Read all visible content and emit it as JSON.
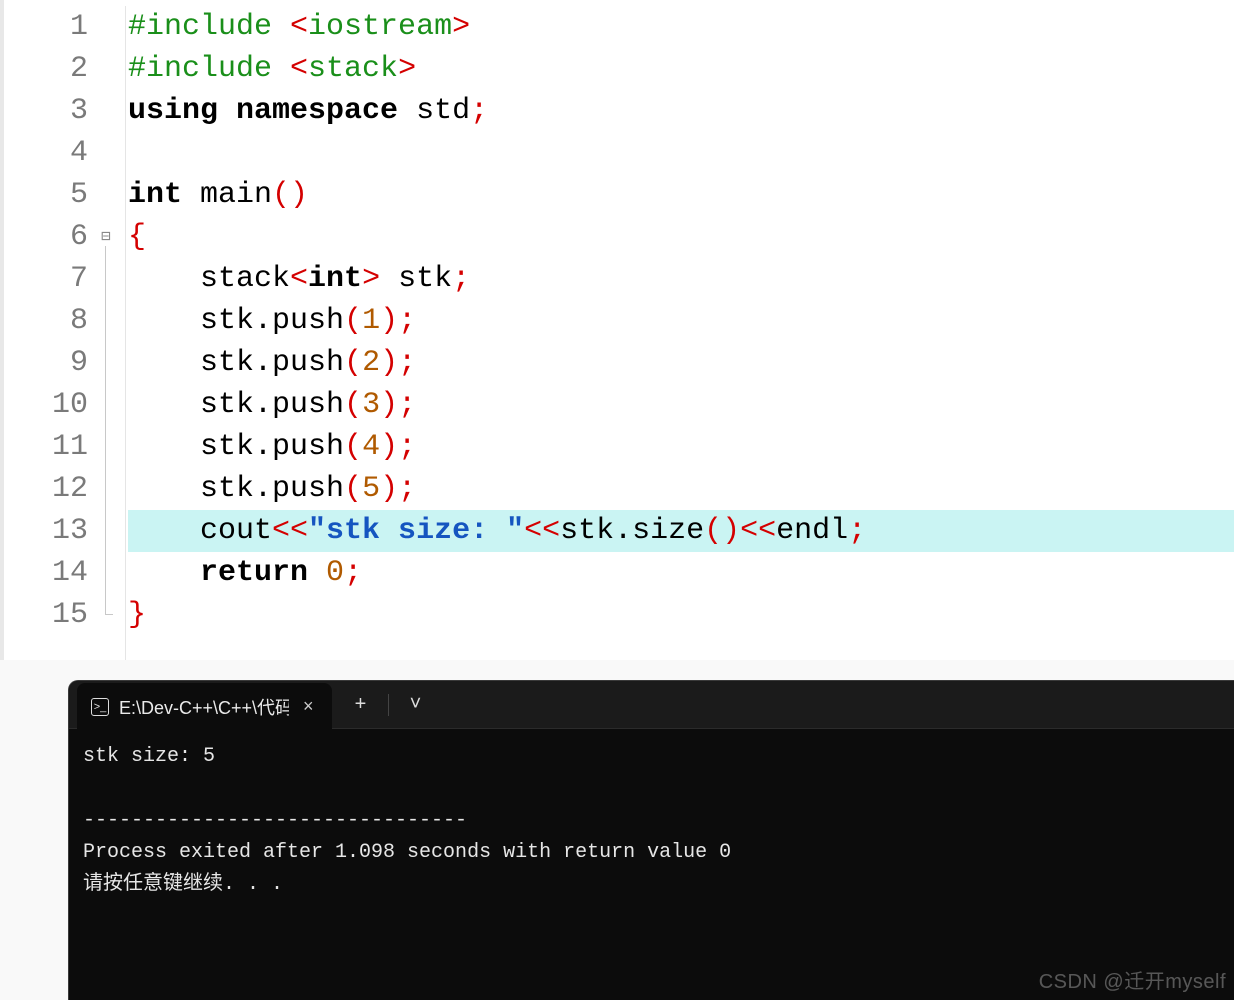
{
  "editor": {
    "highlighted_line": 13,
    "fold_start_line": 6,
    "fold_end_line": 15,
    "lines": [
      {
        "n": 1,
        "tokens": [
          [
            "kw-pp",
            "#include "
          ],
          [
            "sym",
            "<"
          ],
          [
            "kw-pp",
            "iostream"
          ],
          [
            "sym",
            ">"
          ]
        ]
      },
      {
        "n": 2,
        "tokens": [
          [
            "kw-pp",
            "#include "
          ],
          [
            "sym",
            "<"
          ],
          [
            "kw-pp",
            "stack"
          ],
          [
            "sym",
            ">"
          ]
        ]
      },
      {
        "n": 3,
        "tokens": [
          [
            "kw",
            "using "
          ],
          [
            "kw",
            "namespace "
          ],
          [
            "ident",
            "std"
          ],
          [
            "sym",
            ";"
          ]
        ]
      },
      {
        "n": 4,
        "tokens": []
      },
      {
        "n": 5,
        "tokens": [
          [
            "kw",
            "int "
          ],
          [
            "ident",
            "main"
          ],
          [
            "sym",
            "()"
          ]
        ]
      },
      {
        "n": 6,
        "tokens": [
          [
            "sym",
            "{"
          ]
        ]
      },
      {
        "n": 7,
        "tokens": [
          [
            "ident",
            "    stack"
          ],
          [
            "sym",
            "<"
          ],
          [
            "kw",
            "int"
          ],
          [
            "sym",
            "> "
          ],
          [
            "ident",
            "stk"
          ],
          [
            "sym",
            ";"
          ]
        ]
      },
      {
        "n": 8,
        "tokens": [
          [
            "ident",
            "    stk.push"
          ],
          [
            "sym",
            "("
          ],
          [
            "num",
            "1"
          ],
          [
            "sym",
            ");"
          ]
        ]
      },
      {
        "n": 9,
        "tokens": [
          [
            "ident",
            "    stk.push"
          ],
          [
            "sym",
            "("
          ],
          [
            "num",
            "2"
          ],
          [
            "sym",
            ");"
          ]
        ]
      },
      {
        "n": 10,
        "tokens": [
          [
            "ident",
            "    stk.push"
          ],
          [
            "sym",
            "("
          ],
          [
            "num",
            "3"
          ],
          [
            "sym",
            ");"
          ]
        ]
      },
      {
        "n": 11,
        "tokens": [
          [
            "ident",
            "    stk.push"
          ],
          [
            "sym",
            "("
          ],
          [
            "num",
            "4"
          ],
          [
            "sym",
            ");"
          ]
        ]
      },
      {
        "n": 12,
        "tokens": [
          [
            "ident",
            "    stk.push"
          ],
          [
            "sym",
            "("
          ],
          [
            "num",
            "5"
          ],
          [
            "sym",
            ");"
          ]
        ]
      },
      {
        "n": 13,
        "tokens": [
          [
            "ident",
            "    cout"
          ],
          [
            "sym",
            "<<"
          ],
          [
            "str",
            "\"stk size: \""
          ],
          [
            "sym",
            "<<"
          ],
          [
            "ident",
            "stk.size"
          ],
          [
            "sym",
            "()<<"
          ],
          [
            "ident",
            "endl"
          ],
          [
            "sym",
            ";"
          ]
        ]
      },
      {
        "n": 14,
        "tokens": [
          [
            "ident",
            "    "
          ],
          [
            "kw",
            "return "
          ],
          [
            "num",
            "0"
          ],
          [
            "sym",
            ";"
          ]
        ]
      },
      {
        "n": 15,
        "tokens": [
          [
            "sym",
            "}"
          ]
        ]
      }
    ]
  },
  "terminal": {
    "tab_title": "E:\\Dev-C++\\C++\\代码",
    "new_tab_label": "+",
    "dropdown_label": "˅",
    "close_label": "×",
    "output": "stk size: 5\n\n--------------------------------\nProcess exited after 1.098 seconds with return value 0\n请按任意键继续. . ."
  },
  "watermark": "CSDN @迁开myself"
}
